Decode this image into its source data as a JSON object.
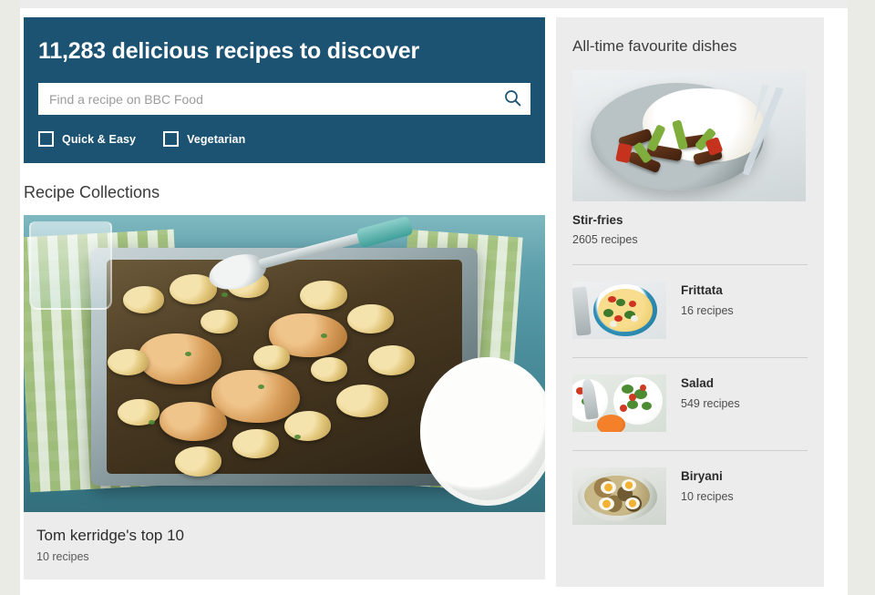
{
  "theme": {
    "page_background": "#e9ebe4",
    "content_background": "#ffffff",
    "hero_blue": "#1c5272",
    "panel_grey": "#ececec",
    "divider_grey": "#cfcfcf"
  },
  "hero": {
    "title": "11,283 delicious recipes to discover",
    "search": {
      "placeholder": "Find a recipe on BBC Food",
      "value": "",
      "button_icon": "search-icon"
    },
    "filters": [
      {
        "label": "Quick & Easy",
        "checked": false
      },
      {
        "label": "Vegetarian",
        "checked": false
      }
    ]
  },
  "collections": {
    "heading": "Recipe Collections",
    "items": [
      {
        "title": "Tom kerridge's top 10",
        "count": "10 recipes",
        "image_alt": "chicken-and-potato-traybake-photo"
      }
    ]
  },
  "sidebar": {
    "heading": "All-time favourite dishes",
    "feature": {
      "title": "Stir-fries",
      "count": "2605 recipes",
      "image_alt": "beef-stir-fry-with-rice-photo"
    },
    "items": [
      {
        "title": "Frittata",
        "count": "16 recipes",
        "image_alt": "frittata-photo"
      },
      {
        "title": "Salad",
        "count": "549 recipes",
        "image_alt": "salad-bowls-photo"
      },
      {
        "title": "Biryani",
        "count": "10 recipes",
        "image_alt": "biryani-with-egg-photo"
      }
    ]
  }
}
